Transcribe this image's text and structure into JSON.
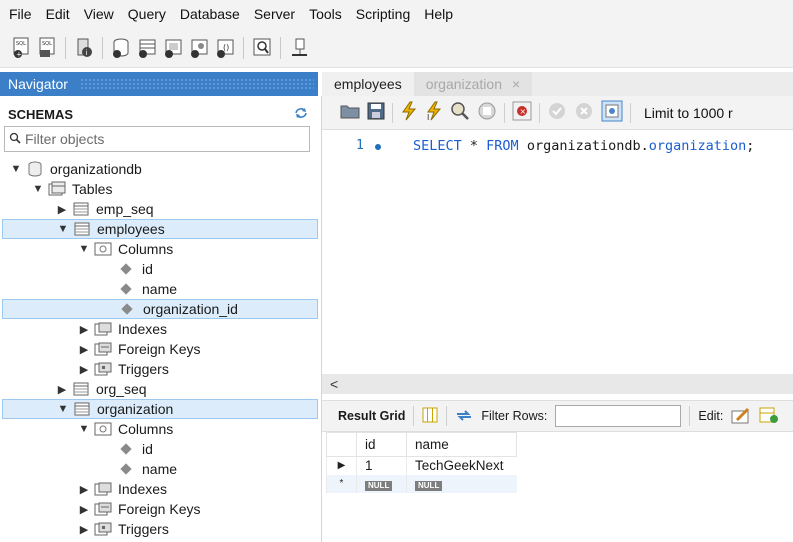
{
  "menu": [
    "File",
    "Edit",
    "View",
    "Query",
    "Database",
    "Server",
    "Tools",
    "Scripting",
    "Help"
  ],
  "navigator": {
    "title": "Navigator",
    "schemas_label": "SCHEMAS",
    "filter_placeholder": "Filter objects",
    "tree": [
      {
        "label": "organizationdb",
        "expanded": true,
        "icon": "database-icon"
      },
      {
        "label": "Tables",
        "expanded": true,
        "icon": "tables-folder-icon"
      },
      {
        "label": "emp_seq",
        "expanded": false,
        "icon": "table-icon"
      },
      {
        "label": "employees",
        "expanded": true,
        "icon": "table-icon",
        "selected": true
      },
      {
        "label": "Columns",
        "expanded": true,
        "icon": "columns-icon"
      },
      {
        "label": "id",
        "icon": "column-icon"
      },
      {
        "label": "name",
        "icon": "column-icon"
      },
      {
        "label": "organization_id",
        "icon": "column-icon",
        "selected": true
      },
      {
        "label": "Indexes",
        "expanded": false,
        "icon": "indexes-icon"
      },
      {
        "label": "Foreign Keys",
        "expanded": false,
        "icon": "foreign-keys-icon"
      },
      {
        "label": "Triggers",
        "expanded": false,
        "icon": "triggers-icon"
      },
      {
        "label": "org_seq",
        "expanded": false,
        "icon": "table-icon"
      },
      {
        "label": "organization",
        "expanded": true,
        "icon": "table-icon",
        "selected": true
      },
      {
        "label": "Columns",
        "expanded": true,
        "icon": "columns-icon"
      },
      {
        "label": "id",
        "icon": "column-icon"
      },
      {
        "label": "name",
        "icon": "column-icon"
      },
      {
        "label": "Indexes",
        "expanded": false,
        "icon": "indexes-icon"
      },
      {
        "label": "Foreign Keys",
        "expanded": false,
        "icon": "foreign-keys-icon"
      },
      {
        "label": "Triggers",
        "expanded": false,
        "icon": "triggers-icon"
      }
    ]
  },
  "tabs": [
    {
      "label": "employees",
      "active": true
    },
    {
      "label": "organization",
      "active": false,
      "close": "×"
    }
  ],
  "sql_toolbar": {
    "limit_label": "Limit to 1000 r"
  },
  "editor": {
    "line_number": "1",
    "sql": {
      "select": "SELECT",
      "star": " * ",
      "from": "FROM",
      "schema": " organizationdb.",
      "table": "organization",
      "semi": ";"
    }
  },
  "scroll_left": "<",
  "result_toolbar": {
    "result_grid": "Result Grid",
    "filter_rows": "Filter Rows:",
    "edit": "Edit:"
  },
  "result": {
    "columns": [
      "id",
      "name"
    ],
    "rows": [
      {
        "marker": "▶",
        "id": "1",
        "name": "TechGeekNext"
      }
    ],
    "new_row": {
      "marker": "*",
      "id": "NULL",
      "name": "NULL"
    }
  },
  "colors": {
    "accent": "#3a7fc8",
    "selection": "#dcecfb",
    "keyword": "#1a5ed0"
  }
}
